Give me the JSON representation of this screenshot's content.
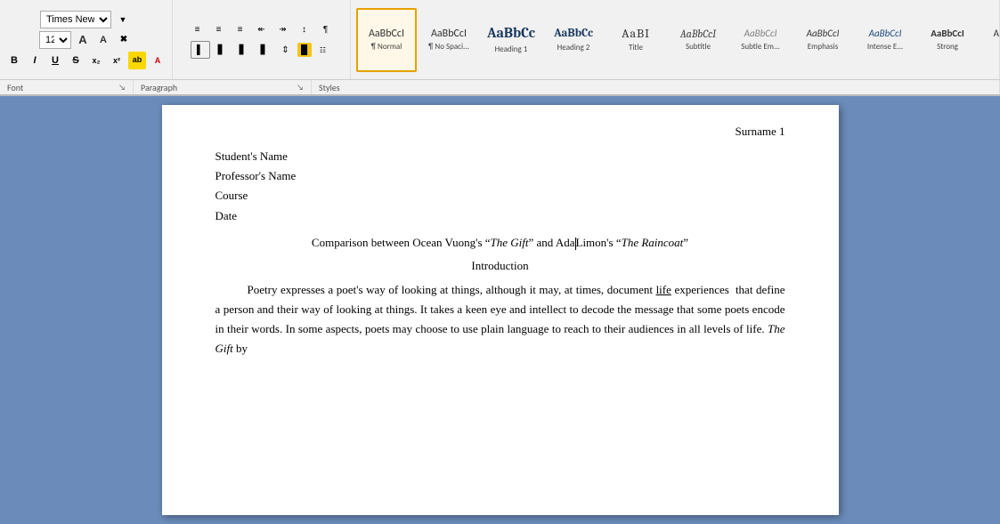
{
  "toolbar": {
    "font": {
      "family": "Times New Roman",
      "size": "12",
      "grow_label": "A",
      "shrink_label": "A"
    },
    "sections": {
      "font_label": "Font",
      "paragraph_label": "Paragraph",
      "styles_label": "Styles"
    },
    "styles": [
      {
        "id": "normal",
        "preview": "AaBbCcI",
        "label": "¶ Normal",
        "active": true,
        "class": "s-normal"
      },
      {
        "id": "no-spacing",
        "preview": "AaBbCcI",
        "label": "¶ No Spaci...",
        "active": false,
        "class": "s-nospace"
      },
      {
        "id": "heading1",
        "preview": "AaBbCc",
        "label": "Heading 1",
        "active": false,
        "class": "s-h1"
      },
      {
        "id": "heading2",
        "preview": "AaBbCc",
        "label": "Heading 2",
        "active": false,
        "class": "s-h2"
      },
      {
        "id": "title",
        "preview": "AaBI",
        "label": "Title",
        "active": false,
        "class": "s-title"
      },
      {
        "id": "subtitle",
        "preview": "AaBbCcI",
        "label": "Subtitle",
        "active": false,
        "class": "s-subtitle"
      },
      {
        "id": "subtle-em",
        "preview": "AaBbCcI",
        "label": "Subtle Em...",
        "active": false,
        "class": "s-subtle-em"
      },
      {
        "id": "emphasis",
        "preview": "AaBbCcI",
        "label": "Emphasis",
        "active": false,
        "class": "s-emphasis"
      },
      {
        "id": "intense-em",
        "preview": "AaBbCcI",
        "label": "Intense E...",
        "active": false,
        "class": "s-intense-em"
      },
      {
        "id": "strong",
        "preview": "AaBbCcI",
        "label": "Strong",
        "active": false,
        "class": "s-strong"
      },
      {
        "id": "more",
        "preview": "AaBbCcI",
        "label": "...",
        "active": false,
        "class": "s-more"
      }
    ]
  },
  "document": {
    "header": "Surname   1",
    "lines": [
      {
        "text": "Student's Name",
        "type": "normal"
      },
      {
        "text": "Professor's Name",
        "type": "normal"
      },
      {
        "text": "Course",
        "type": "normal"
      },
      {
        "text": "Date",
        "type": "normal"
      }
    ],
    "title": "Comparison between Ocean Vuong's “The Gift” and Ada Limon’s “The Raincoat”",
    "intro": "Introduction",
    "body": "Poetry expresses a poet’s way of looking at things, although it may, at times, document life experiences that define a person and their way of looking at things. It takes a keen eye and intellect to decode the message that some poets encode in their words. In some aspects, poets may choose to use plain language to reach to their audiences in all levels of life. The Gift by"
  }
}
